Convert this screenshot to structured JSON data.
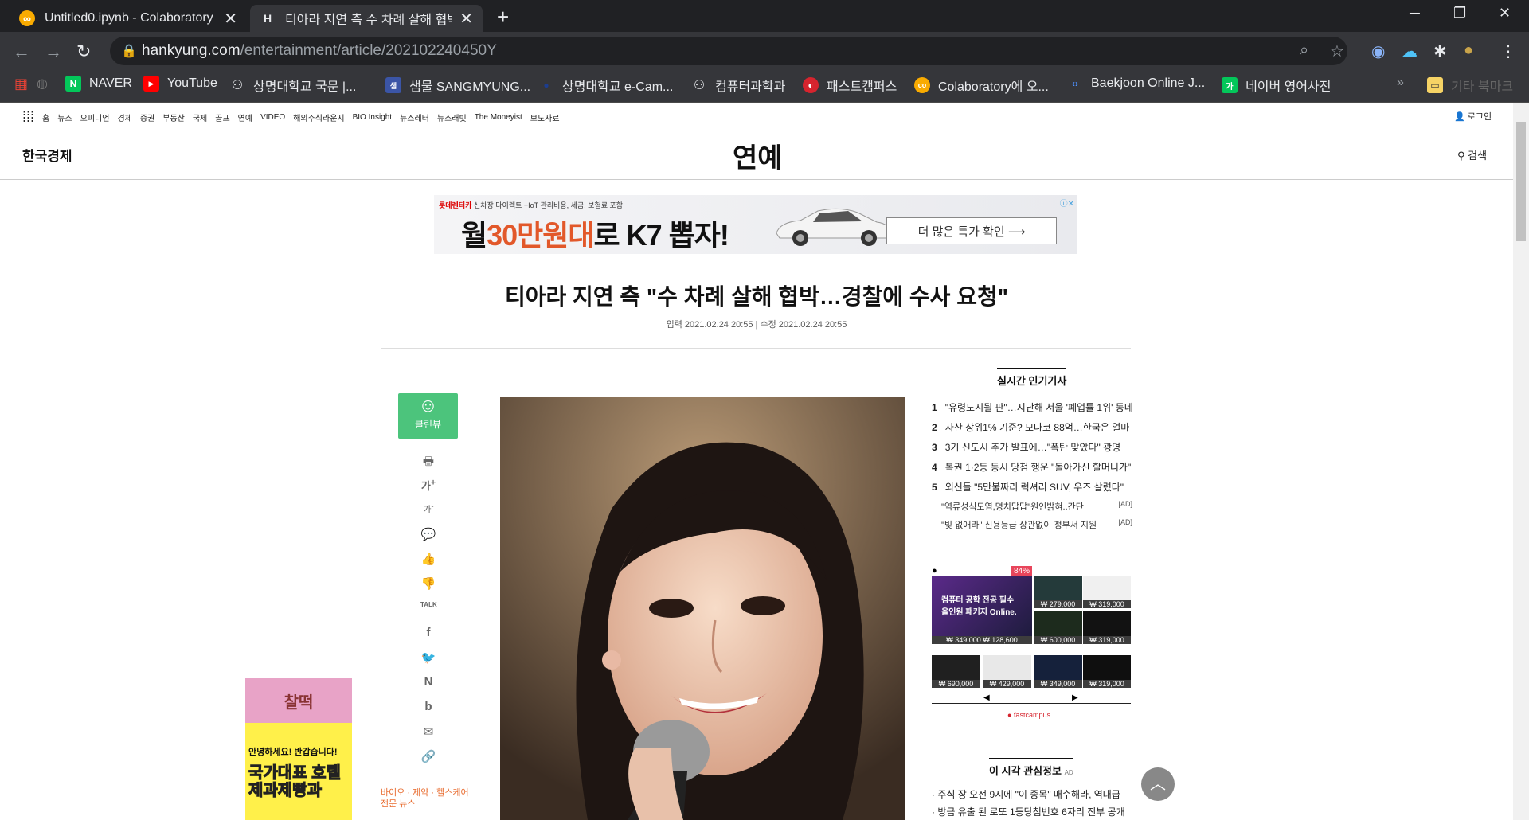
{
  "browser": {
    "tabs": [
      {
        "title": "Untitled0.ipynb - Colaboratory",
        "icon": "colab-icon",
        "active": false
      },
      {
        "title": "티아라 지연 측 수 차례 살해 협박",
        "icon": "hankyung-favicon",
        "icon_text": "H",
        "active": true
      }
    ],
    "new_tab": "+",
    "close": "✕",
    "url_domain": "hankyung.com",
    "url_path": "/entertainment/article/202102240450Y",
    "bookmarks": [
      {
        "label": "",
        "icon": "apps-grid-icon"
      },
      {
        "label": "NAVER",
        "icon_text": "N",
        "color": "#03c75a"
      },
      {
        "label": "YouTube",
        "icon_text": "▶",
        "color": "#ff0000"
      },
      {
        "label": "상명대학교 국문 |...",
        "icon_text": "⚇",
        "color": "#444"
      },
      {
        "label": "샘물 SANGMYUNG...",
        "icon_text": "샘",
        "color": "#3b55a6"
      },
      {
        "label": "상명대학교 e-Cam...",
        "icon_text": "●",
        "color": "#1c3d8f"
      },
      {
        "label": "컴퓨터과학과",
        "icon_text": "⚇",
        "color": "#444"
      },
      {
        "label": "패스트캠퍼스",
        "icon_text": "◐",
        "color": "#d6242e"
      },
      {
        "label": "Colaboratory에 오...",
        "icon_text": "co",
        "color": "#f9ab00"
      },
      {
        "label": "Baekjoon Online J...",
        "icon_text": "‹›",
        "color": "#0076c0"
      },
      {
        "label": "네이버 영어사전",
        "icon_text": "가",
        "color": "#03c75a"
      }
    ],
    "more": "»",
    "other_bookmarks": "기타 북마크"
  },
  "site": {
    "topnav": [
      "홈",
      "뉴스",
      "오피니언",
      "경제",
      "증권",
      "부동산",
      "국제",
      "골프",
      "연예",
      "VIDEO",
      "해외주식라운지",
      "BIO Insight",
      "뉴스레터",
      "뉴스래빗",
      "The Moneyist",
      "보도자료"
    ],
    "login": "로그인",
    "logo": "한국경제",
    "section": "연예",
    "search": "검색"
  },
  "ad_banner": {
    "brand": "롯데렌터카",
    "small": "신차장 다이렉트 +IoT 관리비용, 세금, 보험료 포함",
    "headline_prefix": "월",
    "headline_highlight": "30만원대",
    "headline_suffix": "로 K7 뽑자!",
    "cta": "더 많은 특가 확인 ⟶"
  },
  "article": {
    "headline": "티아라 지연 측 \"수 차례 살해 협박…경찰에 수사 요청\"",
    "dates": "입력 2021.02.24 20:55 | 수정 2021.02.24 20:55"
  },
  "tools": {
    "cleanview": "클린뷰",
    "items": [
      {
        "name": "print-icon",
        "glyph": "🖶"
      },
      {
        "name": "font-increase-icon",
        "glyph": "가⁺"
      },
      {
        "name": "font-decrease-icon",
        "glyph": "가⁻"
      },
      {
        "name": "comment-icon",
        "glyph": "💬"
      },
      {
        "name": "like-icon",
        "glyph": "👍"
      },
      {
        "name": "dislike-icon",
        "glyph": "👎"
      },
      {
        "name": "kakaotalk-icon",
        "glyph": "TALK"
      },
      {
        "name": "facebook-icon",
        "glyph": "f"
      },
      {
        "name": "twitter-icon",
        "glyph": "🐦"
      },
      {
        "name": "naver-icon",
        "glyph": "N"
      },
      {
        "name": "band-icon",
        "glyph": "b"
      },
      {
        "name": "email-icon",
        "glyph": "✉"
      },
      {
        "name": "link-icon",
        "glyph": "🔗"
      }
    ]
  },
  "left_ad": {
    "top": "찰떡",
    "line1": "안녕하세요! 반갑습니다!",
    "line2": "국가대표 호텔제과제빵과"
  },
  "bio_insight": {
    "line1": "바이오 · 제약 · 헬스케어",
    "line2": "전문 뉴스"
  },
  "popular": {
    "title": "실시간 인기기사",
    "items": [
      {
        "num": "1",
        "text": "\"유령도시될 판\"…지난해 서울 '폐업률 1위' 동네"
      },
      {
        "num": "2",
        "text": "자산 상위1% 기준? 모나코 88억…한국은 얼마"
      },
      {
        "num": "3",
        "text": "3기 신도시 추가 발표에…\"폭탄 맞았다\" 광명"
      },
      {
        "num": "4",
        "text": "복권 1·2등 동시 당첨 행운 \"돌아가신 할머니가\""
      },
      {
        "num": "5",
        "text": "외신들 \"5만불짜리 럭셔리 SUV, 우즈 살렸다\""
      }
    ],
    "ads": [
      {
        "text": "\"역류성식도염,명치답답\"원인밝혀..간단",
        "tag": "[AD]"
      },
      {
        "text": "\"빚 없애라\" 신용등급 상관없이 정부서 지원",
        "tag": "[AD]"
      }
    ]
  },
  "fastcampus": {
    "discount": "84%",
    "main_title": "컴퓨터 공학 전공 필수 올인원 패키지 Online.",
    "main_price": "₩ 349,000 ₩ 128,600",
    "prices": [
      "₩ 279,000",
      "₩ 319,000",
      "₩ 600,000",
      "₩ 319,000",
      "₩ 690,000",
      "₩ 429,000",
      "₩ 349,000",
      "₩ 319,000"
    ],
    "left": "◀",
    "right": "▶",
    "logo": "● fastcampus"
  },
  "interest": {
    "title": "이 시각 관심정보",
    "ad": "AD",
    "items": [
      "· 주식 장 오전 9시에 \"이 종목\" 매수해라, 역대급",
      "· 방금 유출 된 로또 1등당첨번호 6자리 전부 공개"
    ]
  },
  "to_top": "︿"
}
